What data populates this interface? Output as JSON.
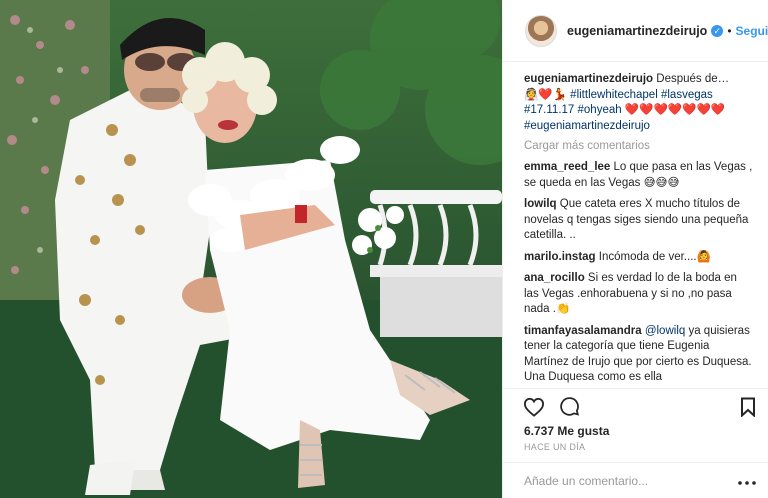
{
  "post": {
    "username": "eugeniamartinezdeirujo",
    "verified_icon": "verified-badge-icon",
    "separator": "•",
    "follow_label": "Seguir"
  },
  "caption": {
    "username": "eugeniamartinezdeirujo",
    "text": "Después de…",
    "emojis": "👰❤️💃",
    "tag1": "#littlewhitechapel",
    "tag2": "#lasvegas",
    "tag3": "#17.11.17",
    "tag4": "#ohyeah",
    "hearts": "❤️❤️❤️❤️❤️❤️❤️",
    "tag5": "#eugeniamartinezdeirujo"
  },
  "load_more": "Cargar más comentarios",
  "comments": [
    {
      "user": "emma_reed_lee",
      "text": "Lo que pasa en las Vegas , se queda en las Vegas 😅😅😅"
    },
    {
      "user": "lowilq",
      "text": "Que cateta eres X mucho títulos de novelas q tengas siges siendo una pequeña catetilla. .."
    },
    {
      "user": "marilo.instag",
      "text": "Incómoda de ver....🙆"
    },
    {
      "user": "ana_rocillo",
      "text": "Si es verdad lo de la boda en las Vegas .enhorabuena y si no ,no pasa nada .👏"
    },
    {
      "user": "timanfayasalamandra",
      "mention": "@lowilq",
      "text": "ya quisieras tener la categoría que tiene Eugenia Martínez de Irujo que por cierto es Duquesa. Una Duquesa como es ella"
    }
  ],
  "likes": "6.737 Me gusta",
  "time": "HACE UN DÍA",
  "add_comment_placeholder": "Añade un comentario...",
  "icons": {
    "like": "heart-icon",
    "comment": "comment-icon",
    "save": "bookmark-icon",
    "options": "more-options-icon"
  },
  "colors": {
    "link": "#3897f0",
    "hashtag": "#003569",
    "muted": "#999999",
    "text": "#262626"
  }
}
